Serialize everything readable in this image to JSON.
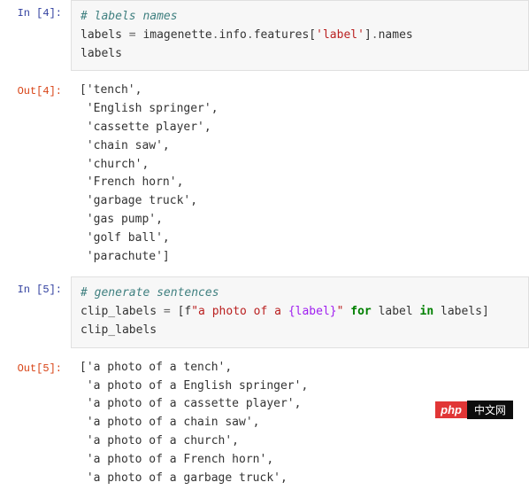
{
  "cells": [
    {
      "in_prompt": "In [4]:",
      "code": {
        "comment": "# labels names",
        "l2_a": "labels ",
        "l2_eq": "=",
        "l2_b": " imagenette",
        "l2_c": ".",
        "l2_d": "info",
        "l2_e": ".",
        "l2_f": "features[",
        "l2_g": "'label'",
        "l2_h": "]",
        "l2_i": ".",
        "l2_j": "names",
        "l3": "labels"
      },
      "out_prompt": "Out[4]:",
      "output": "['tench',\n 'English springer',\n 'cassette player',\n 'chain saw',\n 'church',\n 'French horn',\n 'garbage truck',\n 'gas pump',\n 'golf ball',\n 'parachute']"
    },
    {
      "in_prompt": "In [5]:",
      "code": {
        "comment": "# generate sentences",
        "l2_a": "clip_labels ",
        "l2_eq": "=",
        "l2_b": " [f",
        "l2_c": "\"a photo of a ",
        "l2_d": "{label}",
        "l2_e": "\"",
        "l2_f": " ",
        "l2_for": "for",
        "l2_g": " label ",
        "l2_in": "in",
        "l2_h": " labels]",
        "l3": "clip_labels"
      },
      "out_prompt": "Out[5]:",
      "output": "['a photo of a tench',\n 'a photo of a English springer',\n 'a photo of a cassette player',\n 'a photo of a chain saw',\n 'a photo of a church',\n 'a photo of a French horn',\n 'a photo of a garbage truck',"
    }
  ],
  "watermark": {
    "left": "php",
    "right": "中文网"
  }
}
